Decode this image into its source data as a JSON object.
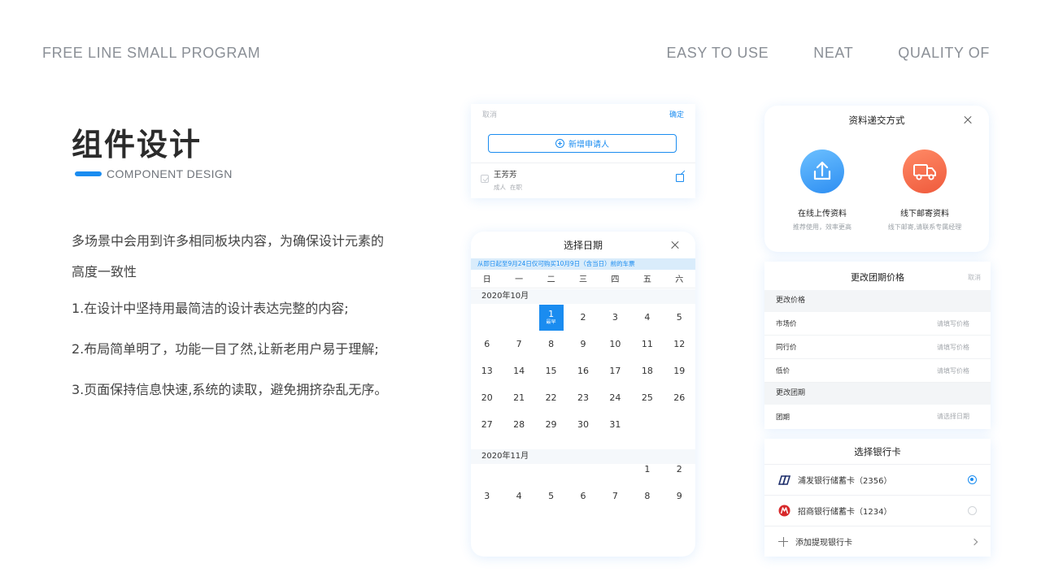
{
  "header": {
    "left": "FREE LINE SMALL PROGRAM",
    "nav": [
      "EASY TO USE",
      "NEAT",
      "QUALITY OF"
    ]
  },
  "intro": {
    "title_cn": "组件设计",
    "title_en": "COMPONENT DESIGN",
    "lead_1": "多场景中会用到许多相同板块内容，为确保设计元素的",
    "lead_2": "高度一致性",
    "points": [
      "1.在设计中坚持用最简洁的设计表达完整的内容;",
      "2.布局简单明了，功能一目了然,让新老用户易于理解;",
      "3.页面保持信息快速,系统的读取，避免拥挤杂乱无序。"
    ]
  },
  "applicant_card": {
    "cancel": "取消",
    "confirm": "确定",
    "add_button": "新增申请人",
    "person_name": "王芳芳",
    "person_tag_1": "成人",
    "person_tag_2": "在职"
  },
  "calendar": {
    "title": "选择日期",
    "notice": "从即日起至9月24日仅可购买10月9日（含当日）前的车票",
    "weekdays": [
      "日",
      "一",
      "二",
      "三",
      "四",
      "五",
      "六"
    ],
    "months": [
      {
        "label": "2020年10月",
        "offset": 2,
        "days": [
          1,
          2,
          3,
          4,
          5,
          6,
          7,
          8,
          9,
          10,
          11,
          12,
          13,
          14,
          15,
          16,
          17,
          18,
          19,
          20,
          21,
          22,
          23,
          24,
          25,
          26,
          27,
          28,
          29,
          30,
          31
        ],
        "selected": 1,
        "selected_note": "最早"
      },
      {
        "label": "2020年11月",
        "offset": 5,
        "days": [
          1,
          2,
          3,
          4,
          5,
          6,
          7,
          8,
          9
        ]
      }
    ]
  },
  "submit_card": {
    "title": "资料递交方式",
    "online_label": "在线上传资料",
    "online_sub": "推荐使用，效率更高",
    "offline_label": "线下邮寄资料",
    "offline_sub": "线下邮寄,请联系专属经理"
  },
  "price_card": {
    "title": "更改团期价格",
    "cancel": "取消",
    "section_price": "更改价格",
    "market_price": "市场价",
    "peer_price": "同行价",
    "low_price": "低价",
    "price_placeholder": "请填写价格",
    "section_date": "更改团期",
    "group_date": "团期",
    "date_placeholder": "请选择日期"
  },
  "bank_card": {
    "title": "选择银行卡",
    "cards": [
      {
        "label": "浦发银行储蓄卡（2356）",
        "selected": true
      },
      {
        "label": "招商银行储蓄卡（1234）",
        "selected": false
      }
    ],
    "add_label": "添加提现银行卡"
  },
  "colors": {
    "accent": "#1a8cf0",
    "muted": "#8a8f96",
    "upload_icon": "#2d8ef2",
    "mail_icon": "#ef5a3c"
  }
}
